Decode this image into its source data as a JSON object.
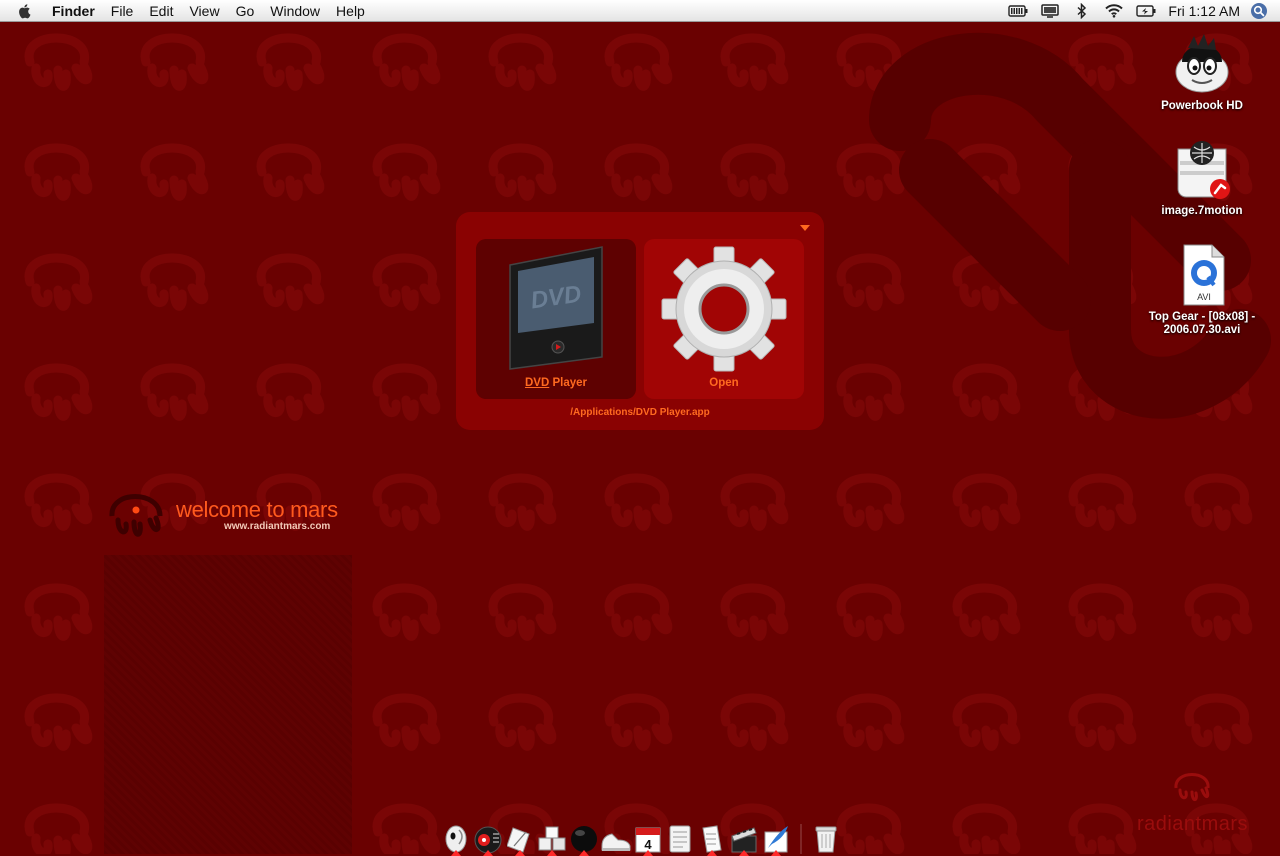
{
  "menubar": {
    "apple_icon": "apple-icon",
    "app_name": "Finder",
    "menus": [
      "File",
      "Edit",
      "View",
      "Go",
      "Window",
      "Help"
    ],
    "status_icons": [
      "battery-icon",
      "display-icon",
      "bluetooth-icon",
      "wifi-icon",
      "power-icon"
    ],
    "clock": "Fri 1:12 AM",
    "spotlight_icon": "spotlight-icon"
  },
  "desktop_icons": [
    {
      "label": "Powerbook HD",
      "icon": "hard-drive-icon"
    },
    {
      "label": "image.7motion",
      "icon": "disk-image-icon"
    },
    {
      "label": "Top Gear - [08x08] - 2006.07.30.avi",
      "icon": "avi-file-icon"
    }
  ],
  "panel": {
    "dvd_label_underlined": "DVD",
    "dvd_label_rest": " Player",
    "open_label": "Open",
    "path": "/Applications/DVD Player.app"
  },
  "welcome": {
    "title": "welcome to mars",
    "url": "www.radiantmars.com"
  },
  "brand": "radiantmars",
  "dock": {
    "items": [
      {
        "name": "finder",
        "running": true
      },
      {
        "name": "dvd-player",
        "running": true
      },
      {
        "name": "textedit",
        "running": true
      },
      {
        "name": "boxes",
        "running": true
      },
      {
        "name": "black-ball",
        "running": true
      },
      {
        "name": "shoe",
        "running": false
      },
      {
        "name": "ical",
        "running": true,
        "date": "4"
      },
      {
        "name": "notes",
        "running": false
      },
      {
        "name": "document",
        "running": true
      },
      {
        "name": "film",
        "running": true
      },
      {
        "name": "feather",
        "running": true
      },
      {
        "name": "trash",
        "running": false
      }
    ]
  },
  "colors": {
    "wallpaper": "#6a0101",
    "accent": "#ff6a20",
    "panel": "#8a0202",
    "dock_indicator": "#ff2a2a"
  }
}
